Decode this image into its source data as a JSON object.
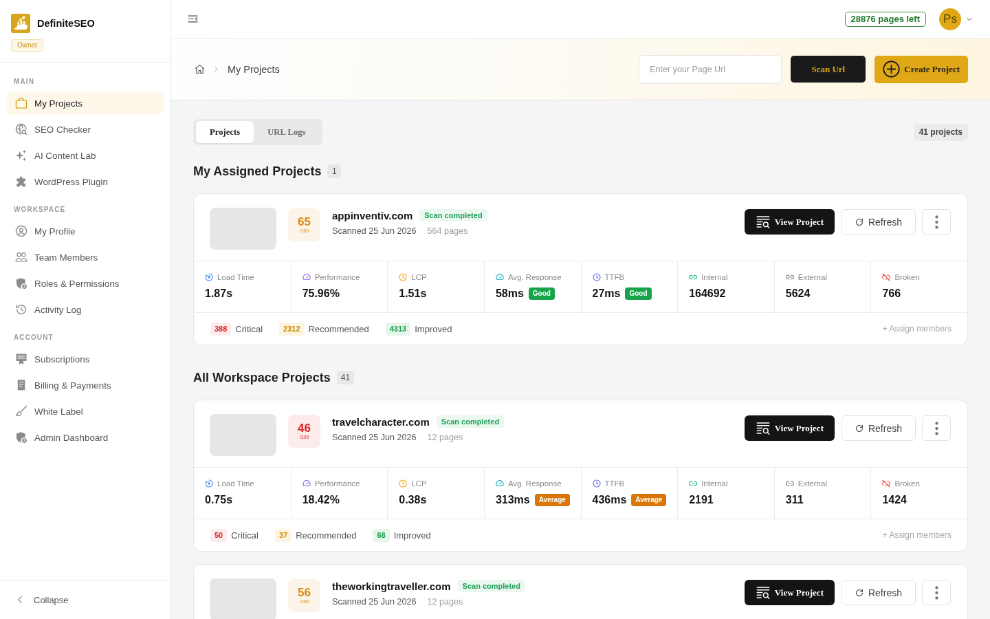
{
  "sidebar": {
    "brand": {
      "name": "DefiniteSEO",
      "role": "Owner"
    },
    "sections": [
      {
        "heading": "MAIN",
        "items": [
          {
            "label": "My Projects",
            "selected": true
          },
          {
            "label": "SEO Checker",
            "selected": false
          },
          {
            "label": "AI Content Lab",
            "selected": false
          },
          {
            "label": "WordPress Plugin",
            "selected": false
          }
        ]
      },
      {
        "heading": "WORKSPACE",
        "items": [
          {
            "label": "My Profile",
            "selected": false
          },
          {
            "label": "Team Members",
            "selected": false
          },
          {
            "label": "Roles & Permissions",
            "selected": false
          },
          {
            "label": "Activity Log",
            "selected": false
          }
        ]
      },
      {
        "heading": "ACCOUNT",
        "items": [
          {
            "label": "Subscriptions",
            "selected": false
          },
          {
            "label": "Billing & Payments",
            "selected": false
          },
          {
            "label": "White Label",
            "selected": false
          },
          {
            "label": "Admin Dashboard",
            "selected": false
          }
        ]
      }
    ],
    "collapse": "Collapse"
  },
  "topbar": {
    "pages_left": "28876 pages left",
    "avatar": "Ps"
  },
  "header": {
    "breadcrumb": "My Projects",
    "url_field": {
      "placeholder": "Enter your Page Url"
    },
    "scan_button": "Scan Url",
    "create_button": "Create Project"
  },
  "tabs": [
    {
      "label": "Projects",
      "selected": true
    },
    {
      "label": "URL Logs",
      "selected": false
    }
  ],
  "project_count": "41 projects",
  "sections": [
    {
      "title": "My Assigned Projects",
      "count": "1",
      "projects": [
        {
          "domain": "appinventiv.com",
          "score": {
            "value": "65",
            "max": "/100",
            "color": "#d98a0b"
          },
          "status": "Scan completed",
          "scanned": "Scanned 25 Jun 2026",
          "pages": "564 pages",
          "actions": {
            "view": "View Project",
            "refresh": "Refresh"
          },
          "metrics": [
            {
              "label": "Load Time",
              "value": "1.87s"
            },
            {
              "label": "Performance",
              "value": "75.96%"
            },
            {
              "label": "LCP",
              "value": "1.51s"
            },
            {
              "label": "Avg. Response",
              "value": "58ms",
              "rating": {
                "label": "Good",
                "color": "#16a34a"
              }
            },
            {
              "label": "TTFB",
              "value": "27ms",
              "rating": {
                "label": "Good",
                "color": "#16a34a"
              }
            },
            {
              "label": "Internal",
              "value": "164692"
            },
            {
              "label": "External",
              "value": "5624"
            },
            {
              "label": "Broken",
              "value": "766"
            }
          ],
          "issues": [
            {
              "count": "388",
              "label": "Critical",
              "kind": "critical"
            },
            {
              "count": "2312",
              "label": "Recommended",
              "kind": "recommended"
            },
            {
              "count": "4313",
              "label": "Improved",
              "kind": "improved"
            }
          ],
          "assign": "+ Assign members"
        }
      ]
    },
    {
      "title": "All Workspace Projects",
      "count": "41",
      "projects": [
        {
          "domain": "travelcharacter.com",
          "score": {
            "value": "46",
            "max": "/100",
            "color": "#dc2626"
          },
          "status": "Scan completed",
          "scanned": "Scanned 25 Jun 2026",
          "pages": "12 pages",
          "actions": {
            "view": "View Project",
            "refresh": "Refresh"
          },
          "metrics": [
            {
              "label": "Load Time",
              "value": "0.75s"
            },
            {
              "label": "Performance",
              "value": "18.42%"
            },
            {
              "label": "LCP",
              "value": "0.38s"
            },
            {
              "label": "Avg. Response",
              "value": "313ms",
              "rating": {
                "label": "Average",
                "color": "#d97706"
              }
            },
            {
              "label": "TTFB",
              "value": "436ms",
              "rating": {
                "label": "Average",
                "color": "#d97706"
              }
            },
            {
              "label": "Internal",
              "value": "2191"
            },
            {
              "label": "External",
              "value": "311"
            },
            {
              "label": "Broken",
              "value": "1424"
            }
          ],
          "issues": [
            {
              "count": "50",
              "label": "Critical",
              "kind": "critical"
            },
            {
              "count": "37",
              "label": "Recommended",
              "kind": "recommended"
            },
            {
              "count": "68",
              "label": "Improved",
              "kind": "improved"
            }
          ],
          "assign": "+ Assign members"
        },
        {
          "domain": "theworkingtraveller.com",
          "score": {
            "value": "56",
            "max": "/100",
            "color": "#d98a0b"
          },
          "status": "Scan completed",
          "scanned": "Scanned 25 Jun 2026",
          "pages": "12 pages",
          "actions": {
            "view": "View Project",
            "refresh": "Refresh"
          }
        }
      ]
    }
  ]
}
